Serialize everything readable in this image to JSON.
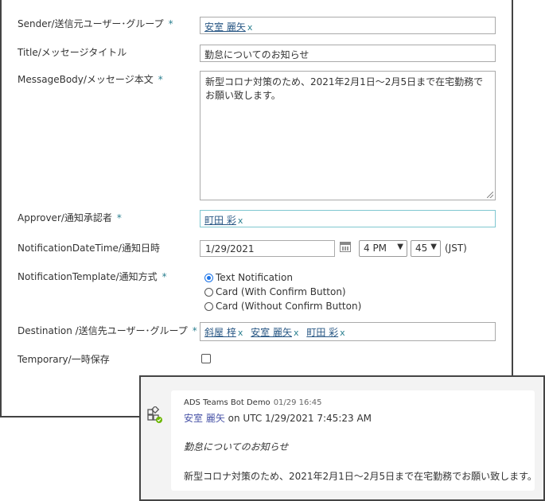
{
  "form": {
    "labels": {
      "sender": "Sender/送信元ユーザー･グループ",
      "title": "Title/メッセージタイトル",
      "body": "MessageBody/メッセージ本文",
      "approver": "Approver/通知承認者",
      "datetime": "NotificationDateTime/通知日時",
      "template": "NotificationTemplate/通知方式",
      "destination": "Destination /送信先ユーザー･グループ",
      "temporary": "Temporary/一時保存"
    },
    "required_mark": "*",
    "remove_mark": "x",
    "sender_people": [
      "安室 麗矢"
    ],
    "title_value": "勤怠についてのお知らせ",
    "body_value": "新型コロナ対策のため、2021年2月1日～2月5日まで在宅勤務でお願い致します。",
    "approver_people": [
      "町田 彩"
    ],
    "date_value": "1/29/2021",
    "hour_value": "4 PM",
    "minute_value": "45",
    "timezone": "(JST)",
    "template_options": [
      "Text Notification",
      "Card (With Confirm Button)",
      "Card (Without Confirm Button)"
    ],
    "template_selected": "Text Notification",
    "destination_people": [
      "斜屋 梓",
      "安室 麗矢",
      "町田 彩"
    ],
    "temporary_checked": false
  },
  "card": {
    "bot_name": "ADS Teams Bot Demo",
    "time": "01/29 16:45",
    "author": "安室 麗矢",
    "on_text": "on UTC 1/29/2021 7:45:23 AM",
    "title": "勤怠についてのお知らせ",
    "body": "新型コロナ対策のため、2021年2月1日～2月5日まで在宅勤務でお願い致します。",
    "icon": "teams-bot-icon"
  },
  "colors": {
    "link": "#2a5885",
    "accent": "#2a7f8f",
    "radio": "#1a73e8",
    "author": "#4a55a8"
  }
}
